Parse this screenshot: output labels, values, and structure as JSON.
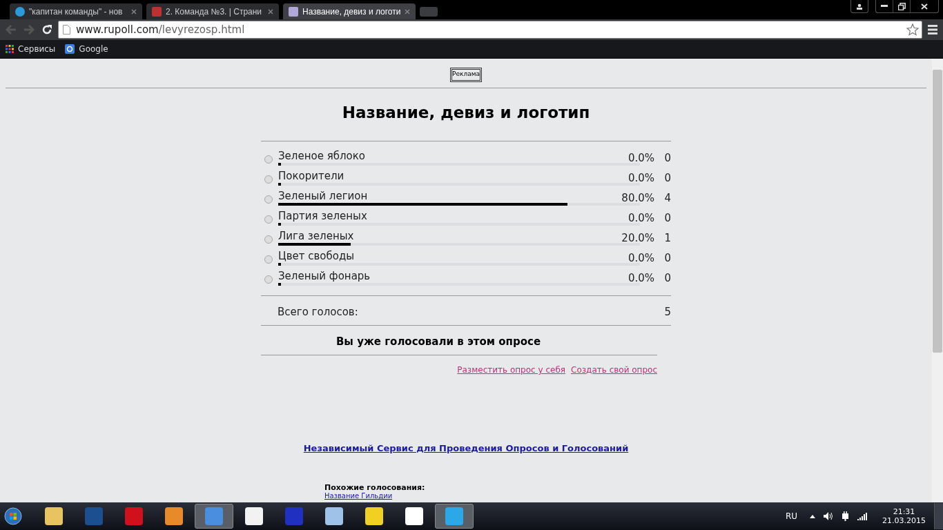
{
  "browser": {
    "tabs": [
      {
        "title": "\"капитан команды\" - нов",
        "selected": false
      },
      {
        "title": "2. Команда №3. | Страни",
        "selected": false
      },
      {
        "title": "Название, девиз и логоти",
        "selected": true
      }
    ],
    "url_host": "www.rupoll.com",
    "url_path": "/levyrezosp.html",
    "bookmarks": [
      {
        "label": "Сервисы"
      },
      {
        "label": "Google"
      }
    ]
  },
  "page": {
    "ad_label": "Реклама",
    "title": "Название, девиз и логотип",
    "options": [
      {
        "label": "Зеленое яблоко",
        "selected": false,
        "level": 0,
        "percent": "0.0%",
        "votes": "0"
      },
      {
        "label": "Покорители",
        "selected": false,
        "level": 0,
        "percent": "0.0%",
        "votes": "0"
      },
      {
        "label": "Зеленый легион",
        "selected": false,
        "level": 0.8,
        "percent": "80.0%",
        "votes": "4"
      },
      {
        "label": "Партия зеленых",
        "selected": false,
        "level": 0,
        "percent": "0.0%",
        "votes": "0"
      },
      {
        "label": "Лига зеленых",
        "selected": false,
        "level": 0.2,
        "percent": "20.0%",
        "votes": "1"
      },
      {
        "label": "Цвет свободы",
        "selected": false,
        "level": 0,
        "percent": "0.0%",
        "votes": "0"
      },
      {
        "label": "Зеленый фонарь",
        "selected": false,
        "level": 0,
        "percent": "0.0%",
        "votes": "0"
      }
    ],
    "total_label": "Всего голосов:",
    "total": "5",
    "notice": "Вы уже голосовали в этом опросе",
    "links": [
      "Разместить опрос у себя",
      "Создать свой опрос"
    ],
    "service_link": "Независимый Сервис для Проведения Опросов и Голосований",
    "similar_heading": "Похожие голосования:",
    "similar": [
      "Название Гильдии"
    ]
  },
  "taskbar": {
    "apps": [
      {
        "active": false
      },
      {
        "active": false
      },
      {
        "active": false
      },
      {
        "active": false
      },
      {
        "active": true
      },
      {
        "active": false
      },
      {
        "active": false
      },
      {
        "active": false
      },
      {
        "active": false
      },
      {
        "active": false
      },
      {
        "active": true
      }
    ],
    "language": "RU",
    "time": "21:31",
    "date": "21.03.2015"
  }
}
